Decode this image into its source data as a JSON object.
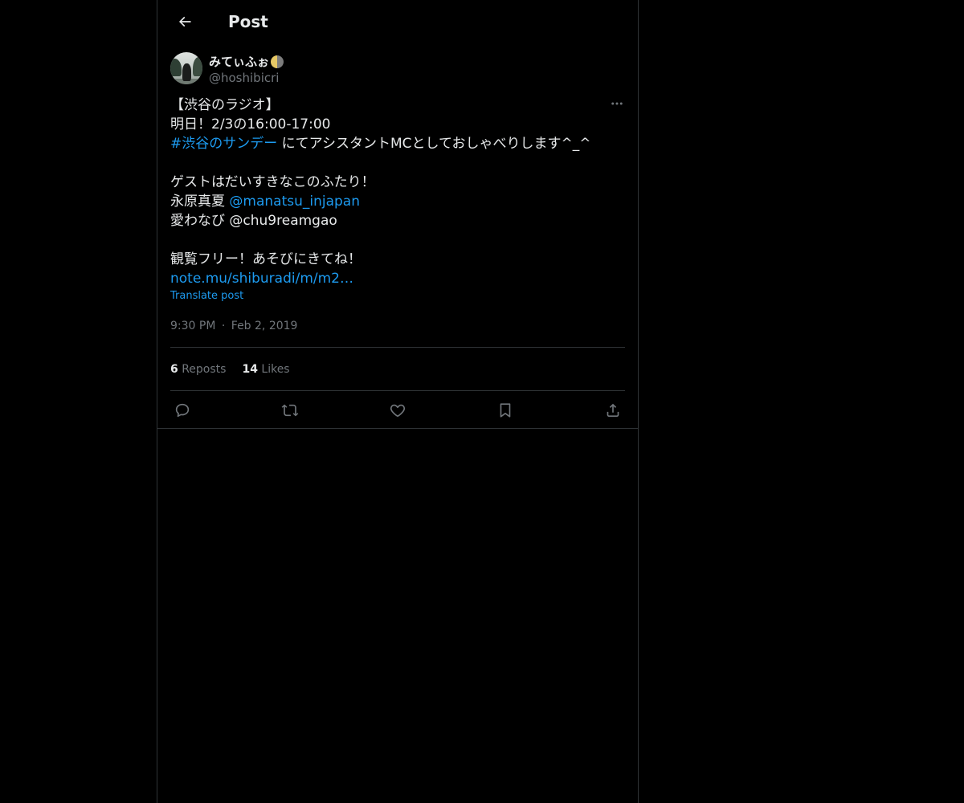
{
  "header": {
    "title": "Post"
  },
  "author": {
    "display_name": "みてぃふぉ",
    "handle": "@hoshibicri"
  },
  "post": {
    "lines": [
      {
        "text": "【渋谷のラジオ】"
      },
      {
        "text": "明日！2/3の16:00-17:00"
      },
      {
        "link": "#渋谷のサンデー",
        "text": " にてアシスタントMCとしておしゃべりします^_^"
      },
      {
        "text": ""
      },
      {
        "text": "ゲストはだいすきなこのふたり！"
      },
      {
        "text": "永原真夏 ",
        "link": "@manatsu_injapan"
      },
      {
        "text": "愛わなび @chu9reamgao"
      },
      {
        "text": ""
      },
      {
        "text": "観覧フリー！あそびにきてね！"
      },
      {
        "link": "note.mu/shiburadi/m/m2…"
      }
    ],
    "translate_label": "Translate post",
    "time": "9:30 PM",
    "separator": "·",
    "date": "Feb 2, 2019"
  },
  "stats": {
    "reposts_count": "6",
    "reposts_label": "Reposts",
    "likes_count": "14",
    "likes_label": "Likes"
  },
  "icons": {
    "back": "arrow-left-icon",
    "more": "more-horizontal-icon",
    "reply": "reply-icon",
    "repost": "repost-icon",
    "like": "heart-icon",
    "bookmark": "bookmark-icon",
    "share": "share-icon",
    "emoji": "moon-icon"
  },
  "colors": {
    "background": "#000000",
    "text": "#e7e9ea",
    "secondary": "#71767b",
    "accent": "#1d9bf0",
    "border": "#2f3336"
  }
}
